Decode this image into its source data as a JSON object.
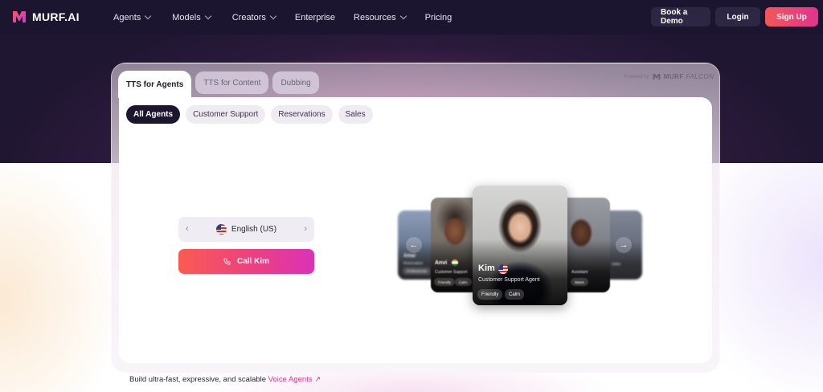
{
  "nav": {
    "brand": "MURF.AI",
    "links": [
      "Agents",
      "Models",
      "Creators",
      "Enterprise",
      "Resources",
      "Pricing"
    ],
    "has_dropdown": [
      true,
      true,
      true,
      false,
      true,
      false
    ],
    "book_demo": "Book a Demo",
    "login": "Login",
    "signup": "Sign Up"
  },
  "tabs": [
    "TTS for Agents",
    "TTS for Content",
    "Dubbing"
  ],
  "powered": {
    "label": "Powered by",
    "brand": "MURF",
    "model": "FALCON"
  },
  "filters": [
    "All Agents",
    "Customer Support",
    "Reservations",
    "Sales"
  ],
  "language": {
    "value": "English (US)",
    "prev": "‹",
    "next": "›"
  },
  "call_button": "Call Kim",
  "agents": {
    "main": {
      "name": "Kim",
      "role": "Customer Support Agent",
      "tags": [
        "Friendly",
        "Calm"
      ]
    },
    "left": {
      "name": "Anvi",
      "role": "Customer Support",
      "tags": [
        "Friendly",
        "Calm"
      ]
    },
    "far_left": {
      "name": "Amar",
      "role": "Reservation",
      "tags": [
        "Professional"
      ]
    },
    "right": {
      "role": "Assistant",
      "tags": [
        "Warm"
      ]
    },
    "far_right": {
      "role": "Sales"
    }
  },
  "carousel_prev": "←",
  "carousel_next": "→",
  "bottom": {
    "text": "Build ultra-fast, expressive, and scalable ",
    "link": "Voice Agents ↗"
  },
  "colors": {
    "accent": "#e0348f",
    "nav_bg": "#1c1530",
    "chip_active": "#1e1630"
  }
}
